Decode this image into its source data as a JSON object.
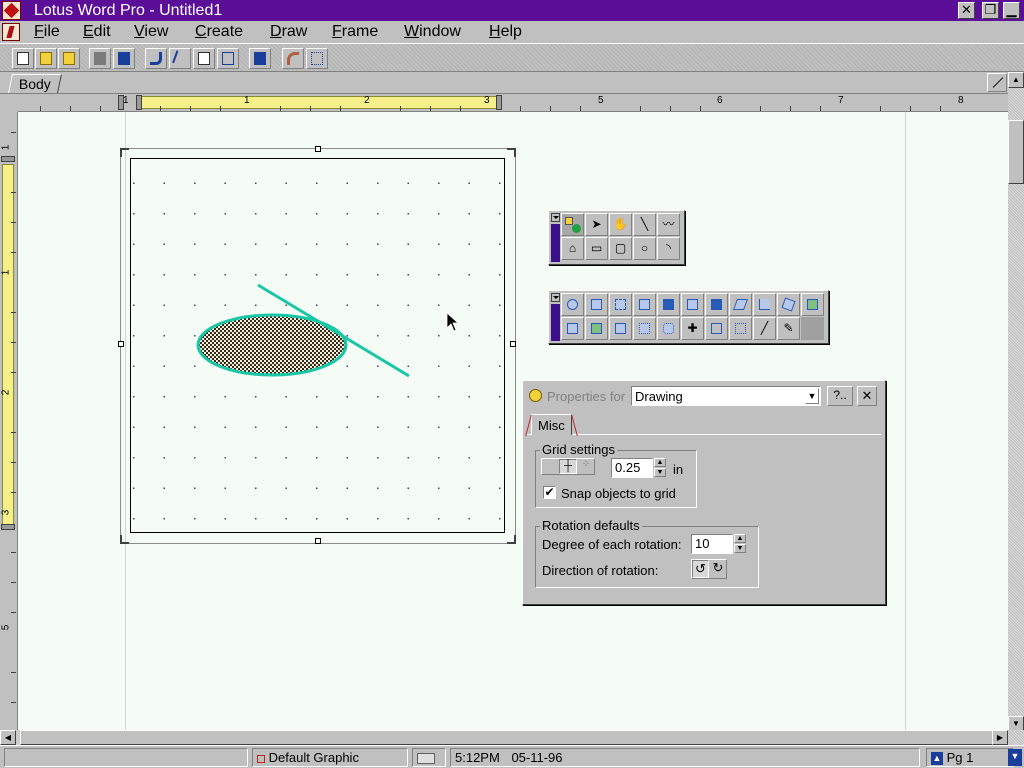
{
  "window": {
    "title": "Lotus Word Pro - Untitled1"
  },
  "menu": [
    "File",
    "Edit",
    "View",
    "Create",
    "Draw",
    "Frame",
    "Window",
    "Help"
  ],
  "tabs": {
    "body": "Body"
  },
  "ruler": {
    "h_numbers": [
      "1",
      "1",
      "2",
      "3",
      "5",
      "6",
      "7",
      "8"
    ],
    "v_numbers": [
      "1",
      "1",
      "2",
      "3",
      "5"
    ]
  },
  "draw_toolbar": {
    "row1_icons": [
      "select-shapes-icon",
      "arrow-icon",
      "hand-icon",
      "line-icon",
      "polyline-icon"
    ],
    "row2_icons": [
      "polygon-icon",
      "rectangle-icon",
      "rounded-rectangle-icon",
      "ellipse-icon",
      "arc-icon"
    ]
  },
  "arrange_toolbar": {
    "row1_icons": [
      "zoom-icon",
      "group-icon",
      "ungroup-icon",
      "bring-front-icon",
      "send-back-icon",
      "bring-forward-icon",
      "send-backward-icon",
      "flip-icon",
      "align-icon",
      "rotate-icon",
      "extract-icon"
    ],
    "row2_icons": [
      "distribute-icon",
      "combine-icon",
      "split-icon",
      "grid-icon",
      "snap-icon",
      "center-icon",
      "frame-icon",
      "show-grid-icon",
      "edit-points-icon",
      "pen-icon"
    ]
  },
  "properties": {
    "label": "Properties for",
    "target": "Drawing",
    "help_label": "?..",
    "close_label": "✕",
    "tab": "Misc",
    "grid": {
      "title": "Grid settings",
      "spacing": "0.25",
      "unit": "in",
      "snap_label": "Snap objects to grid",
      "snap_checked": true
    },
    "rotation": {
      "title": "Rotation defaults",
      "degree_label": "Degree of each rotation:",
      "degree_value": "10",
      "direction_label": "Direction of rotation:"
    }
  },
  "status": {
    "style": "Default Graphic",
    "time": "5:12PM",
    "date": "05-11-96",
    "page": "Pg 1"
  },
  "colors": {
    "titlebar": "#5b0f98",
    "accent_purple": "#3c0f8a",
    "shape_outline": "#19c7a7",
    "document_bg": "#f5fbf5"
  }
}
